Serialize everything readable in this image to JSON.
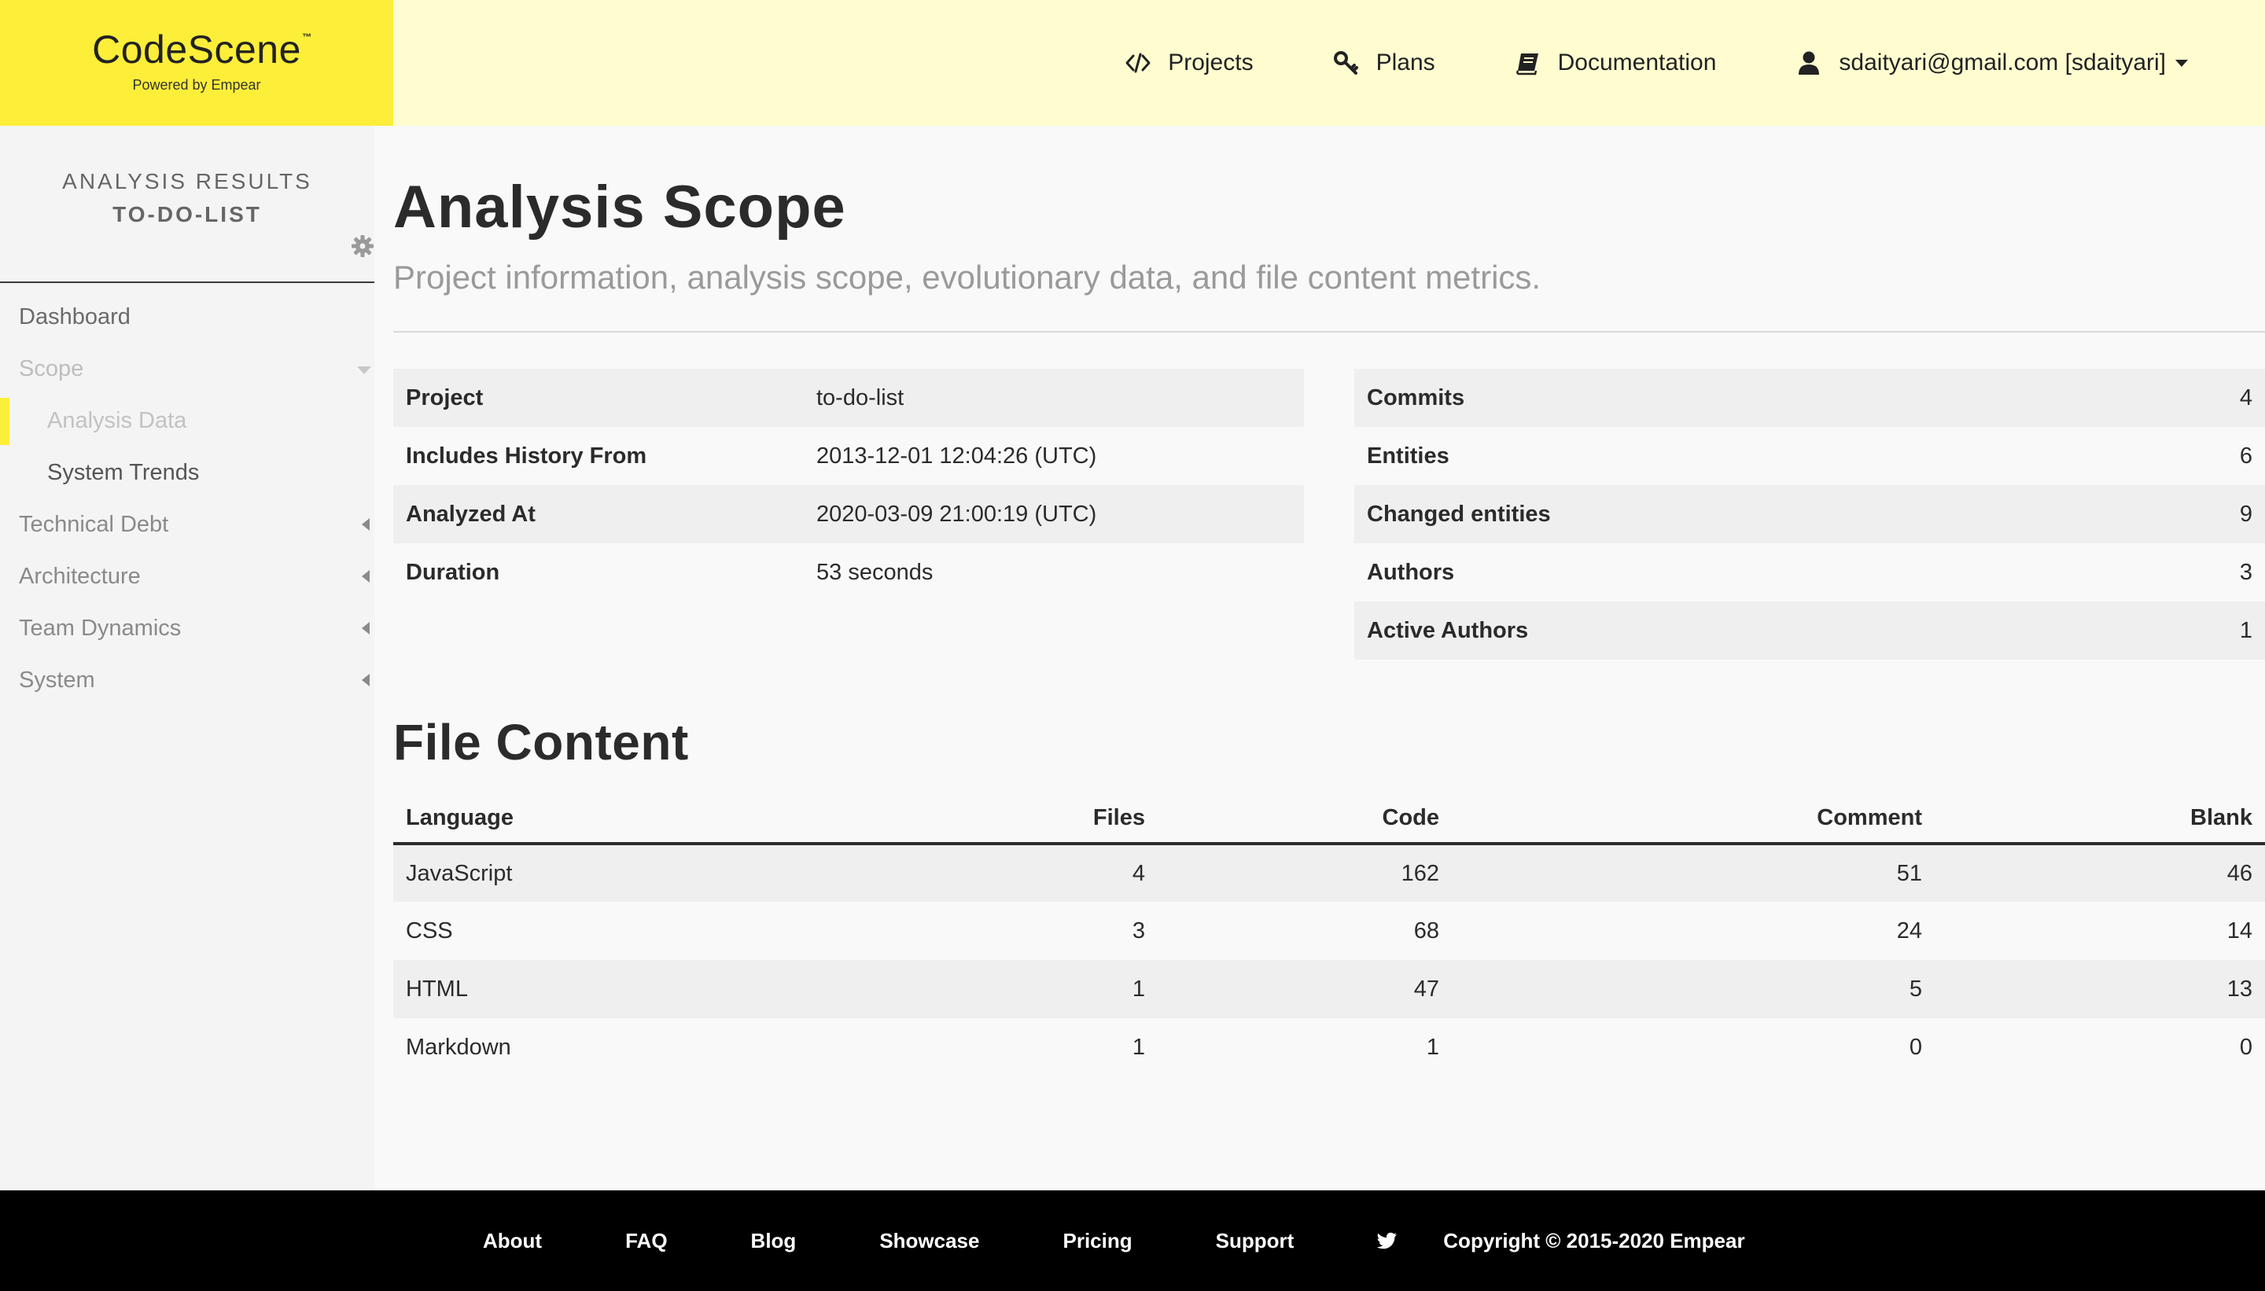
{
  "brand": {
    "name": "CodeScene",
    "tm": "™",
    "tagline": "Powered by Empear",
    "color": "#fdee3a"
  },
  "topnav": {
    "projects": "Projects",
    "plans": "Plans",
    "documentation": "Documentation",
    "user": "sdaityari@gmail.com [sdaityari]"
  },
  "sidebar": {
    "title": "ANALYSIS RESULTS",
    "project": "TO-DO-LIST",
    "items": [
      {
        "label": "Dashboard"
      },
      {
        "label": "Scope"
      },
      {
        "label": "Analysis Data"
      },
      {
        "label": "System Trends"
      },
      {
        "label": "Technical Debt"
      },
      {
        "label": "Architecture"
      },
      {
        "label": "Team Dynamics"
      },
      {
        "label": "System"
      }
    ]
  },
  "page": {
    "title": "Analysis Scope",
    "subtitle": "Project information, analysis scope, evolutionary data, and file content metrics."
  },
  "project_info": [
    {
      "key": "Project",
      "value": "to-do-list"
    },
    {
      "key": "Includes History From",
      "value": "2013-12-01 12:04:26 (UTC)"
    },
    {
      "key": "Analyzed At",
      "value": "2020-03-09 21:00:19 (UTC)"
    },
    {
      "key": "Duration",
      "value": "53 seconds"
    }
  ],
  "stats": [
    {
      "key": "Commits",
      "value": "4"
    },
    {
      "key": "Entities",
      "value": "6"
    },
    {
      "key": "Changed entities",
      "value": "9"
    },
    {
      "key": "Authors",
      "value": "3"
    },
    {
      "key": "Active Authors",
      "value": "1"
    }
  ],
  "file_content": {
    "title": "File Content",
    "headers": {
      "language": "Language",
      "files": "Files",
      "code": "Code",
      "comment": "Comment",
      "blank": "Blank"
    },
    "rows": [
      {
        "language": "JavaScript",
        "files": "4",
        "code": "162",
        "comment": "51",
        "blank": "46"
      },
      {
        "language": "CSS",
        "files": "3",
        "code": "68",
        "comment": "24",
        "blank": "14"
      },
      {
        "language": "HTML",
        "files": "1",
        "code": "47",
        "comment": "5",
        "blank": "13"
      },
      {
        "language": "Markdown",
        "files": "1",
        "code": "1",
        "comment": "0",
        "blank": "0"
      }
    ]
  },
  "footer": {
    "links": [
      "About",
      "FAQ",
      "Blog",
      "Showcase",
      "Pricing",
      "Support"
    ],
    "copyright": "Copyright © 2015-2020 Empear"
  },
  "icons": {
    "projects": "code-icon",
    "plans": "key-icon",
    "documentation": "book-icon",
    "user": "user-icon",
    "settings": "gear-icon",
    "twitter": "twitter-icon"
  }
}
